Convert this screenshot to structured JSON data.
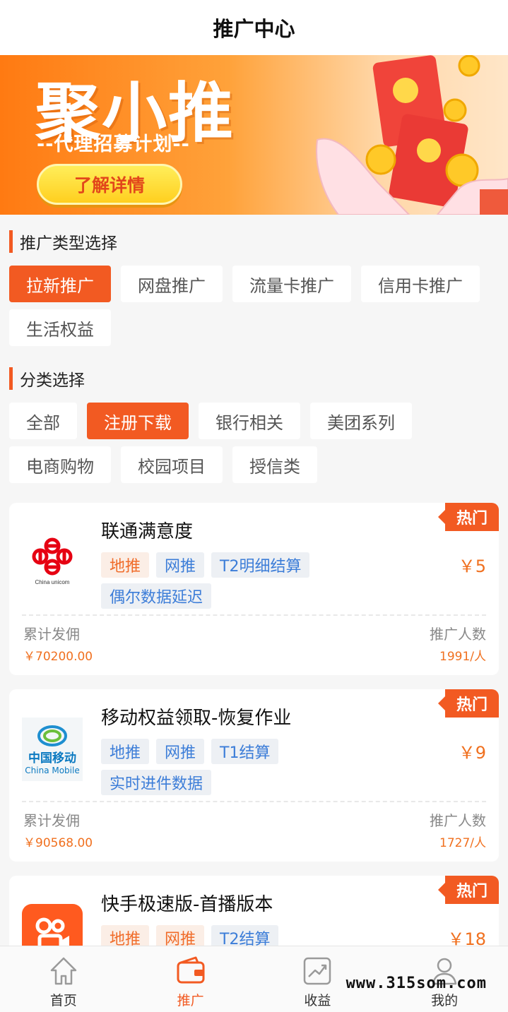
{
  "header": {
    "title": "推广中心"
  },
  "banner": {
    "title": "聚小推",
    "subtitle": "--代理招募计划--",
    "button_label": "了解详情"
  },
  "type_section": {
    "title": "推广类型选择",
    "options": [
      "拉新推广",
      "网盘推广",
      "流量卡推广",
      "信用卡推广",
      "生活权益"
    ],
    "selected": "拉新推广"
  },
  "category_section": {
    "title": "分类选择",
    "options": [
      "全部",
      "注册下载",
      "银行相关",
      "美团系列",
      "电商购物",
      "校园项目",
      "授信类"
    ],
    "selected": "注册下载"
  },
  "products": [
    {
      "name": "联通满意度",
      "logo": "china-unicom-logo",
      "badge": "热门",
      "tags": [
        {
          "label": "地推",
          "color": "orange"
        },
        {
          "label": "网推",
          "color": "blue"
        },
        {
          "label": "T2明细结算",
          "color": "blue"
        },
        {
          "label": "偶尔数据延迟",
          "color": "blue"
        }
      ],
      "price": "￥5",
      "total_label": "累计发佣",
      "total_value": "￥70200.00",
      "count_label": "推广人数",
      "count_value": "1991/人"
    },
    {
      "name": "移动权益领取-恢复作业",
      "logo": "china-mobile-logo",
      "logo_text_cn": "中国移动",
      "logo_text_en": "China Mobile",
      "badge": "热门",
      "tags": [
        {
          "label": "地推",
          "color": "blue"
        },
        {
          "label": "网推",
          "color": "blue"
        },
        {
          "label": "T1结算",
          "color": "blue"
        },
        {
          "label": "实时进件数据",
          "color": "blue"
        }
      ],
      "price": "￥9",
      "total_label": "累计发佣",
      "total_value": "￥90568.00",
      "count_label": "推广人数",
      "count_value": "1727/人"
    },
    {
      "name": "快手极速版-首播版本",
      "logo": "kuaishou-logo",
      "badge": "热门",
      "tags": [
        {
          "label": "地推",
          "color": "orange"
        },
        {
          "label": "网推",
          "color": "orange"
        },
        {
          "label": "T2结算",
          "color": "blue"
        }
      ],
      "price": "￥18"
    }
  ],
  "tabbar": {
    "items": [
      {
        "label": "首页",
        "icon": "home-icon"
      },
      {
        "label": "推广",
        "icon": "wallet-icon",
        "active": true
      },
      {
        "label": "收益",
        "icon": "chart-icon"
      },
      {
        "label": "我的",
        "icon": "user-icon"
      }
    ]
  },
  "watermark": "www.315som.com",
  "colors": {
    "accent": "#f25a22",
    "price": "#f0701f",
    "tag_blue": "#3c7dd8"
  }
}
